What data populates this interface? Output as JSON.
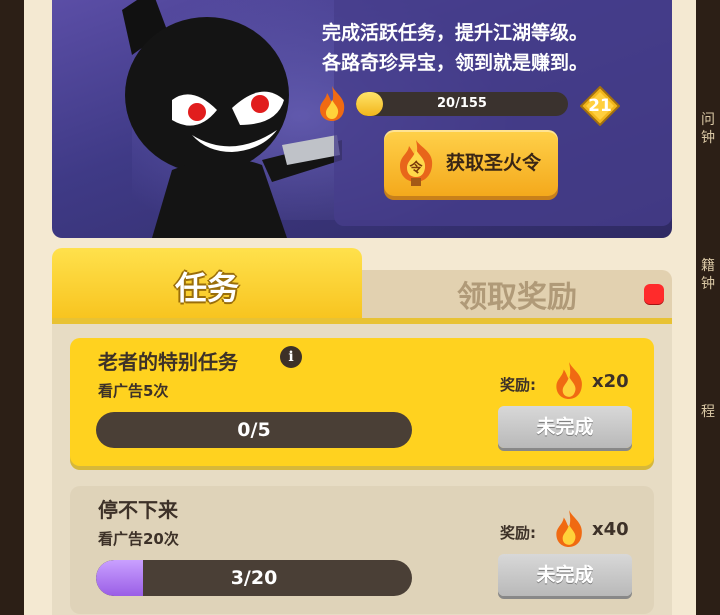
{
  "banner": {
    "description_line1": "完成活跃任务，提升江湖等级。",
    "description_line2": "各路奇珍异宝，领到就是赚到。",
    "progress_text": "20/155",
    "progress_fraction": 0.129,
    "level": "21",
    "get_button_label": "获取圣火令",
    "token_glyph": "令"
  },
  "side": {
    "right_labels": [
      "问",
      "钟",
      "籍",
      "钟",
      "程"
    ]
  },
  "tabs": [
    {
      "label": "任务",
      "active": true
    },
    {
      "label": "领取奖励",
      "active": false
    }
  ],
  "tasks": [
    {
      "title": "老者的特别任务",
      "info_icon": "i",
      "subtitle": "看广告5次",
      "progress_text": "0/5",
      "progress_fraction": 0.0,
      "reward_label": "奖励:",
      "reward_count": "x20",
      "status_label": "未完成"
    },
    {
      "title": "停不下来",
      "subtitle": "看广告20次",
      "progress_text": "3/20",
      "progress_fraction": 0.15,
      "reward_label": "奖励:",
      "reward_count": "x40",
      "status_label": "未完成"
    }
  ],
  "colors": {
    "accent_yellow": "#ffd21f",
    "banner_purple": "#4a3f92",
    "progress_purple": "#9a5ee6",
    "notify_red": "#ff2b2b"
  },
  "icons": [
    "ninja-character",
    "fire-icon",
    "level-diamond-icon",
    "holy-fire-token-icon",
    "info-icon",
    "notification-dot"
  ]
}
